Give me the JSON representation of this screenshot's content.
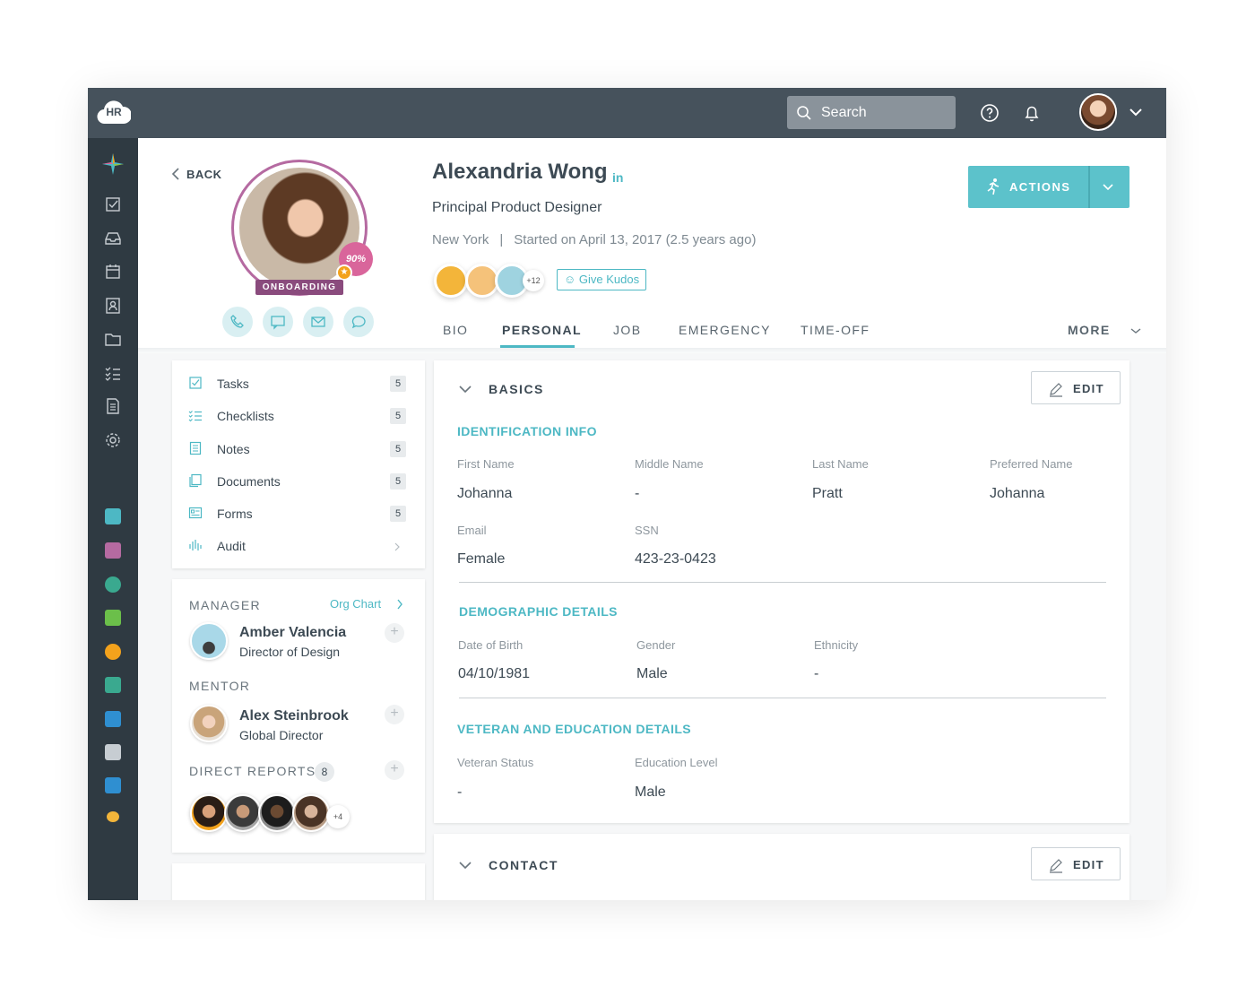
{
  "app": {
    "logo_text": "HR"
  },
  "topbar": {
    "search_placeholder": "Search"
  },
  "profile": {
    "back_label": "BACK",
    "name": "Alexandria Wong",
    "linkedin": "in",
    "title": "Principal Product Designer",
    "location": "New York",
    "separator": "|",
    "started": "Started on April 13, 2017 (2.5 years ago)",
    "completion": "90%",
    "status_badge": "ONBOARDING",
    "kudos_more": "+12",
    "give_kudos": "Give Kudos",
    "actions_label": "ACTIONS"
  },
  "tabs": [
    {
      "label": "BIO"
    },
    {
      "label": "PERSONAL",
      "active": true
    },
    {
      "label": "JOB"
    },
    {
      "label": "EMERGENCY"
    },
    {
      "label": "TIME-OFF"
    }
  ],
  "more_label": "MORE",
  "left_nav": [
    {
      "label": "Tasks",
      "count": "5",
      "icon": "checkbox-icon"
    },
    {
      "label": "Checklists",
      "count": "5",
      "icon": "checklist-icon"
    },
    {
      "label": "Notes",
      "count": "5",
      "icon": "notes-icon"
    },
    {
      "label": "Documents",
      "count": "5",
      "icon": "documents-icon"
    },
    {
      "label": "Forms",
      "count": "5",
      "icon": "forms-icon"
    },
    {
      "label": "Audit",
      "count": "",
      "icon": "audit-icon"
    }
  ],
  "relations": {
    "manager_label": "MANAGER",
    "org_chart": "Org Chart",
    "manager": {
      "name": "Amber Valencia",
      "role": "Director of Design"
    },
    "mentor_label": "MENTOR",
    "mentor": {
      "name": "Alex Steinbrook",
      "role": "Global Director"
    },
    "direct_reports_label": "DIRECT REPORTS",
    "direct_reports_count": "8",
    "direct_reports_more": "+4"
  },
  "basics": {
    "title": "BASICS",
    "edit": "EDIT",
    "identification": {
      "title": "IDENTIFICATION INFO",
      "first_name_label": "First Name",
      "first_name": "Johanna",
      "middle_name_label": "Middle Name",
      "middle_name": "-",
      "last_name_label": "Last Name",
      "last_name": "Pratt",
      "preferred_name_label": "Preferred Name",
      "preferred_name": "Johanna",
      "email_label": "Email",
      "email": "Female",
      "ssn_label": "SSN",
      "ssn": "423-23-0423"
    },
    "demographic": {
      "title": "DEMOGRAPHIC DETAILS",
      "dob_label": "Date of Birth",
      "dob": "04/10/1981",
      "gender_label": "Gender",
      "gender": "Male",
      "ethnicity_label": "Ethnicity",
      "ethnicity": "-"
    },
    "veteran": {
      "title": "VETERAN AND EDUCATION DETAILS",
      "status_label": "Veteran Status",
      "status": "-",
      "education_label": "Education Level",
      "education": "Male"
    }
  },
  "contact": {
    "title": "CONTACT",
    "edit": "EDIT"
  },
  "colors": {
    "accent": "#4db8c4",
    "topbar": "#46525c",
    "sidebar": "#2f3a42",
    "onboarding": "#8a4b7d",
    "completion": "#d9659b"
  }
}
